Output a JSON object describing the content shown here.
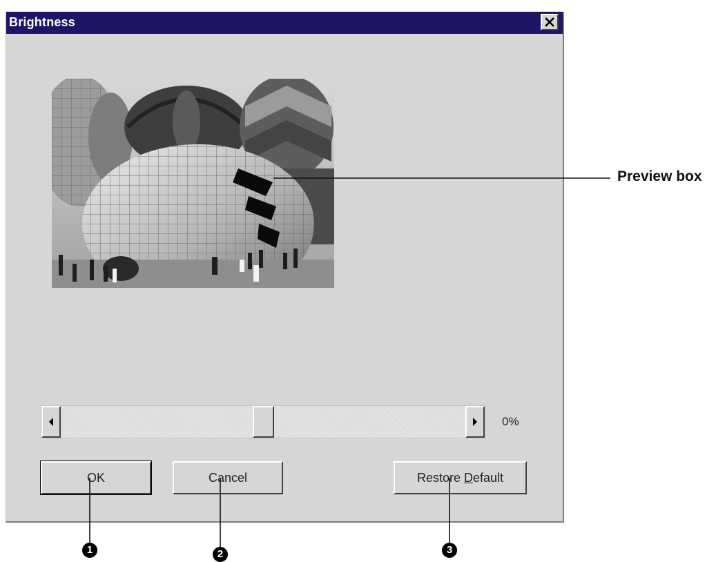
{
  "dialog": {
    "title": "Brightness",
    "close_icon": "close-icon"
  },
  "slider": {
    "value_text": "0%",
    "position_fraction": 0.5
  },
  "buttons": {
    "ok": "OK",
    "cancel": "Cancel",
    "restore_prefix": "Restore ",
    "restore_mnemonic": "D",
    "restore_suffix": "efault"
  },
  "annotations": {
    "preview_label": "Preview box",
    "marker_1": "1",
    "marker_2": "2",
    "marker_3": "3"
  },
  "colors": {
    "titlebar": "#1f1566",
    "dialog_bg": "#d6d6d6"
  }
}
